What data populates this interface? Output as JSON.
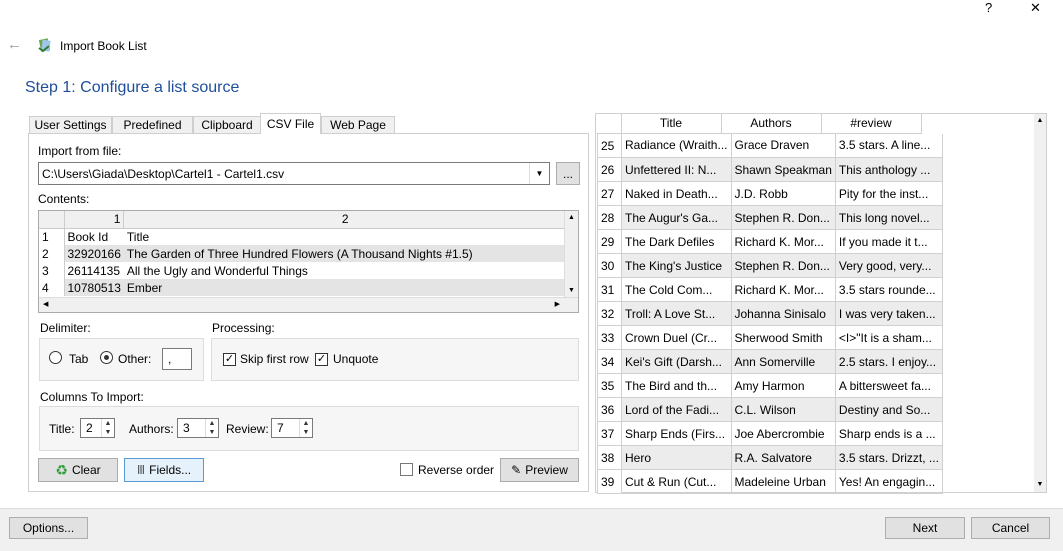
{
  "window": {
    "help": "?",
    "close": "✕",
    "back": "←",
    "title": "Import Book List"
  },
  "step_title": "Step 1: Configure a list source",
  "tabs": [
    "User Settings",
    "Predefined",
    "Clipboard",
    "CSV File",
    "Web Page"
  ],
  "import_from_file": {
    "label": "Import from file:",
    "value": "C:\\Users\\Giada\\Desktop\\Cartel1 - Cartel1.csv",
    "browse": "..."
  },
  "contents": {
    "label": "Contents:",
    "columns": [
      "1",
      "2"
    ],
    "rows": [
      [
        "1",
        "Book Id",
        "Title"
      ],
      [
        "2",
        "32920166",
        "The Garden of Three Hundred Flowers (A Thousand Nights #1.5)"
      ],
      [
        "3",
        "26114135",
        "All the Ugly and Wonderful Things"
      ],
      [
        "4",
        "10780513",
        "Ember"
      ]
    ]
  },
  "delimiter": {
    "label": "Delimiter:",
    "tab": "Tab",
    "other": "Other:",
    "other_value": ","
  },
  "processing": {
    "label": "Processing:",
    "skip_first_row": "Skip first row",
    "unquote": "Unquote"
  },
  "columns_to_import": {
    "label": "Columns To Import:",
    "title_label": "Title:",
    "title_value": "2",
    "authors_label": "Authors:",
    "authors_value": "3",
    "review_label": "Review:",
    "review_value": "7"
  },
  "buttons": {
    "clear": "Clear",
    "fields": "Fields...",
    "reverse_order": "Reverse order",
    "preview": "Preview",
    "options": "Options...",
    "next": "Next",
    "cancel": "Cancel"
  },
  "preview_table": {
    "headers": [
      "Title",
      "Authors",
      "#review"
    ],
    "rows": [
      [
        "25",
        "Radiance (Wraith...",
        "Grace Draven",
        "3.5 stars. A line..."
      ],
      [
        "26",
        "Unfettered II: N...",
        "Shawn Speakman",
        "This anthology ..."
      ],
      [
        "27",
        "Naked in Death...",
        "J.D. Robb",
        "Pity for the inst..."
      ],
      [
        "28",
        "The Augur's Ga...",
        "Stephen R. Don...",
        "This long novel..."
      ],
      [
        "29",
        "The Dark Defiles",
        "Richard K. Mor...",
        "If you made it t..."
      ],
      [
        "30",
        "The King's Justice",
        "Stephen R. Don...",
        "Very good, very..."
      ],
      [
        "31",
        "The Cold Com...",
        "Richard K. Mor...",
        "3.5 stars rounde..."
      ],
      [
        "32",
        "Troll: A Love St...",
        "Johanna Sinisalo",
        "I was very taken..."
      ],
      [
        "33",
        "Crown Duel (Cr...",
        "Sherwood Smith",
        "<I>\"It is a sham..."
      ],
      [
        "34",
        "Kei's Gift (Darsh...",
        "Ann Somerville",
        "2.5 stars. I enjoy..."
      ],
      [
        "35",
        "The Bird and th...",
        "Amy Harmon",
        "A bittersweet fa..."
      ],
      [
        "36",
        "Lord of the Fadi...",
        "C.L. Wilson",
        "Destiny and So..."
      ],
      [
        "37",
        "Sharp Ends (Firs...",
        "Joe Abercrombie",
        "Sharp ends is a ..."
      ],
      [
        "38",
        "Hero",
        "R.A. Salvatore",
        "3.5 stars. Drizzt, ..."
      ],
      [
        "39",
        "Cut & Run (Cut...",
        "Madeleine Urban",
        "Yes! An engagin..."
      ]
    ]
  },
  "colors": {
    "accent": "#1f4e99",
    "alt_row": "#ececec",
    "button": "#e1e1e1",
    "bottom_bar": "#f0f0f0"
  }
}
